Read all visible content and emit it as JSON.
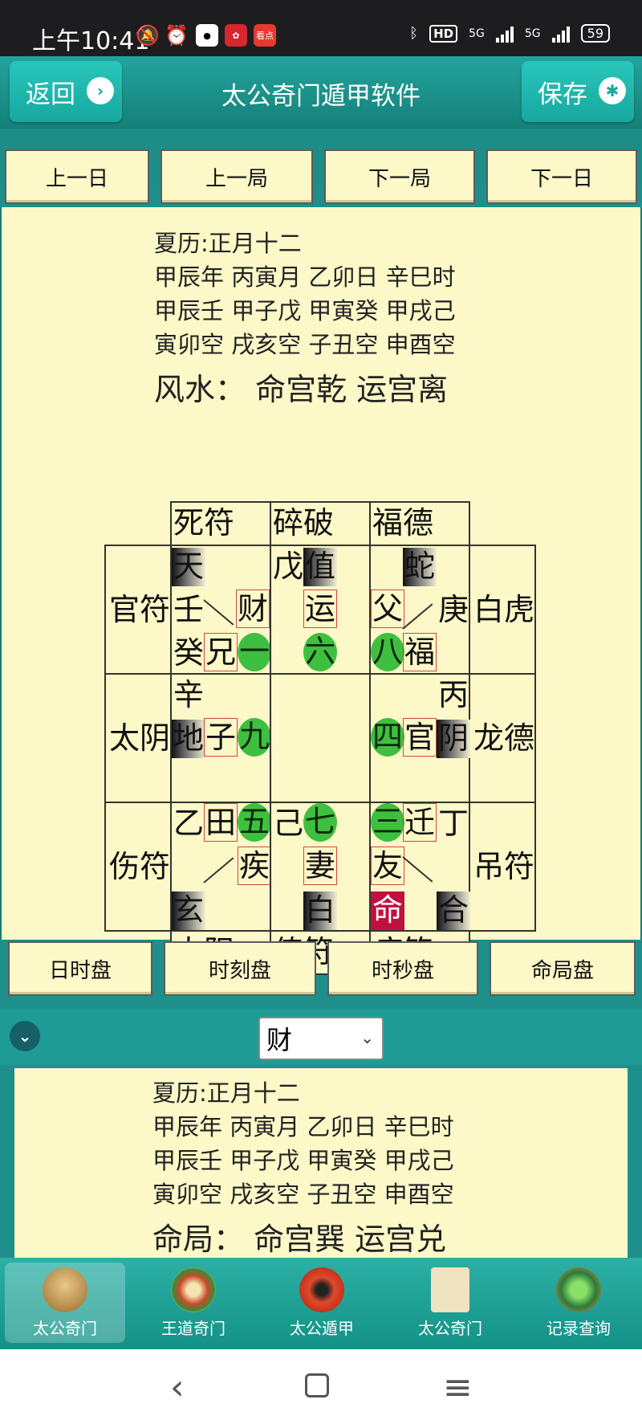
{
  "status": {
    "time": "上午10:41",
    "hd": "HD",
    "network1": "5G",
    "network2": "5G",
    "battery": "59",
    "app_icon_label": "看点"
  },
  "header": {
    "back_label": "返回",
    "title": "太公奇门遁甲软件",
    "save_label": "保存"
  },
  "nav_top": [
    "上一日",
    "上一局",
    "下一局",
    "下一日"
  ],
  "panel1": {
    "lines": [
      "夏历:正月十二",
      "甲辰年 丙寅月 乙卯日 辛巳时",
      "甲辰壬 甲子戊 甲寅癸 甲戌己",
      "寅卯空 戌亥空 子丑空 申酉空"
    ],
    "headline": "风水： 命宫乾 运宫离"
  },
  "chart": {
    "top": [
      "死符",
      "碎破",
      "福德"
    ],
    "left": [
      "官符",
      "太阴",
      "伤符"
    ],
    "right": [
      "白虎",
      "龙德",
      "吊符"
    ],
    "bottom": [
      "太阳",
      "值符",
      "病符"
    ],
    "glyphs": [
      "天",
      "壬",
      "财",
      "癸",
      "兄",
      "一",
      "戊",
      "值",
      "运",
      "六",
      "蛇",
      "父",
      "庚",
      "八",
      "福",
      "辛",
      "地",
      "子",
      "九",
      "丙",
      "四",
      "官",
      "阴",
      "乙",
      "田",
      "五",
      "疾",
      "玄",
      "己",
      "七",
      "妻",
      "白",
      "三",
      "迁",
      "丁",
      "友",
      "命",
      "合"
    ]
  },
  "nav_bottom": [
    "日时盘",
    "时刻盘",
    "时秒盘",
    "命局盘"
  ],
  "selector": {
    "value": "财"
  },
  "panel2": {
    "lines": [
      "夏历:正月十二",
      "甲辰年 丙寅月 乙卯日 辛巳时",
      "甲辰壬 甲子戊 甲寅癸 甲戌己",
      "寅卯空 戌亥空 子丑空 申酉空"
    ],
    "headline": "命局： 命宫巽 运宫兑"
  },
  "tabs": [
    "太公奇门",
    "王道奇门",
    "太公遁甲",
    "太公奇门",
    "记录查询"
  ],
  "colors": {
    "teal": "#1e8f8a",
    "cream": "#fdf8c8",
    "green_circle": "#3fbf3f",
    "red_box": "#d04545",
    "ming_red": "#c01040"
  }
}
